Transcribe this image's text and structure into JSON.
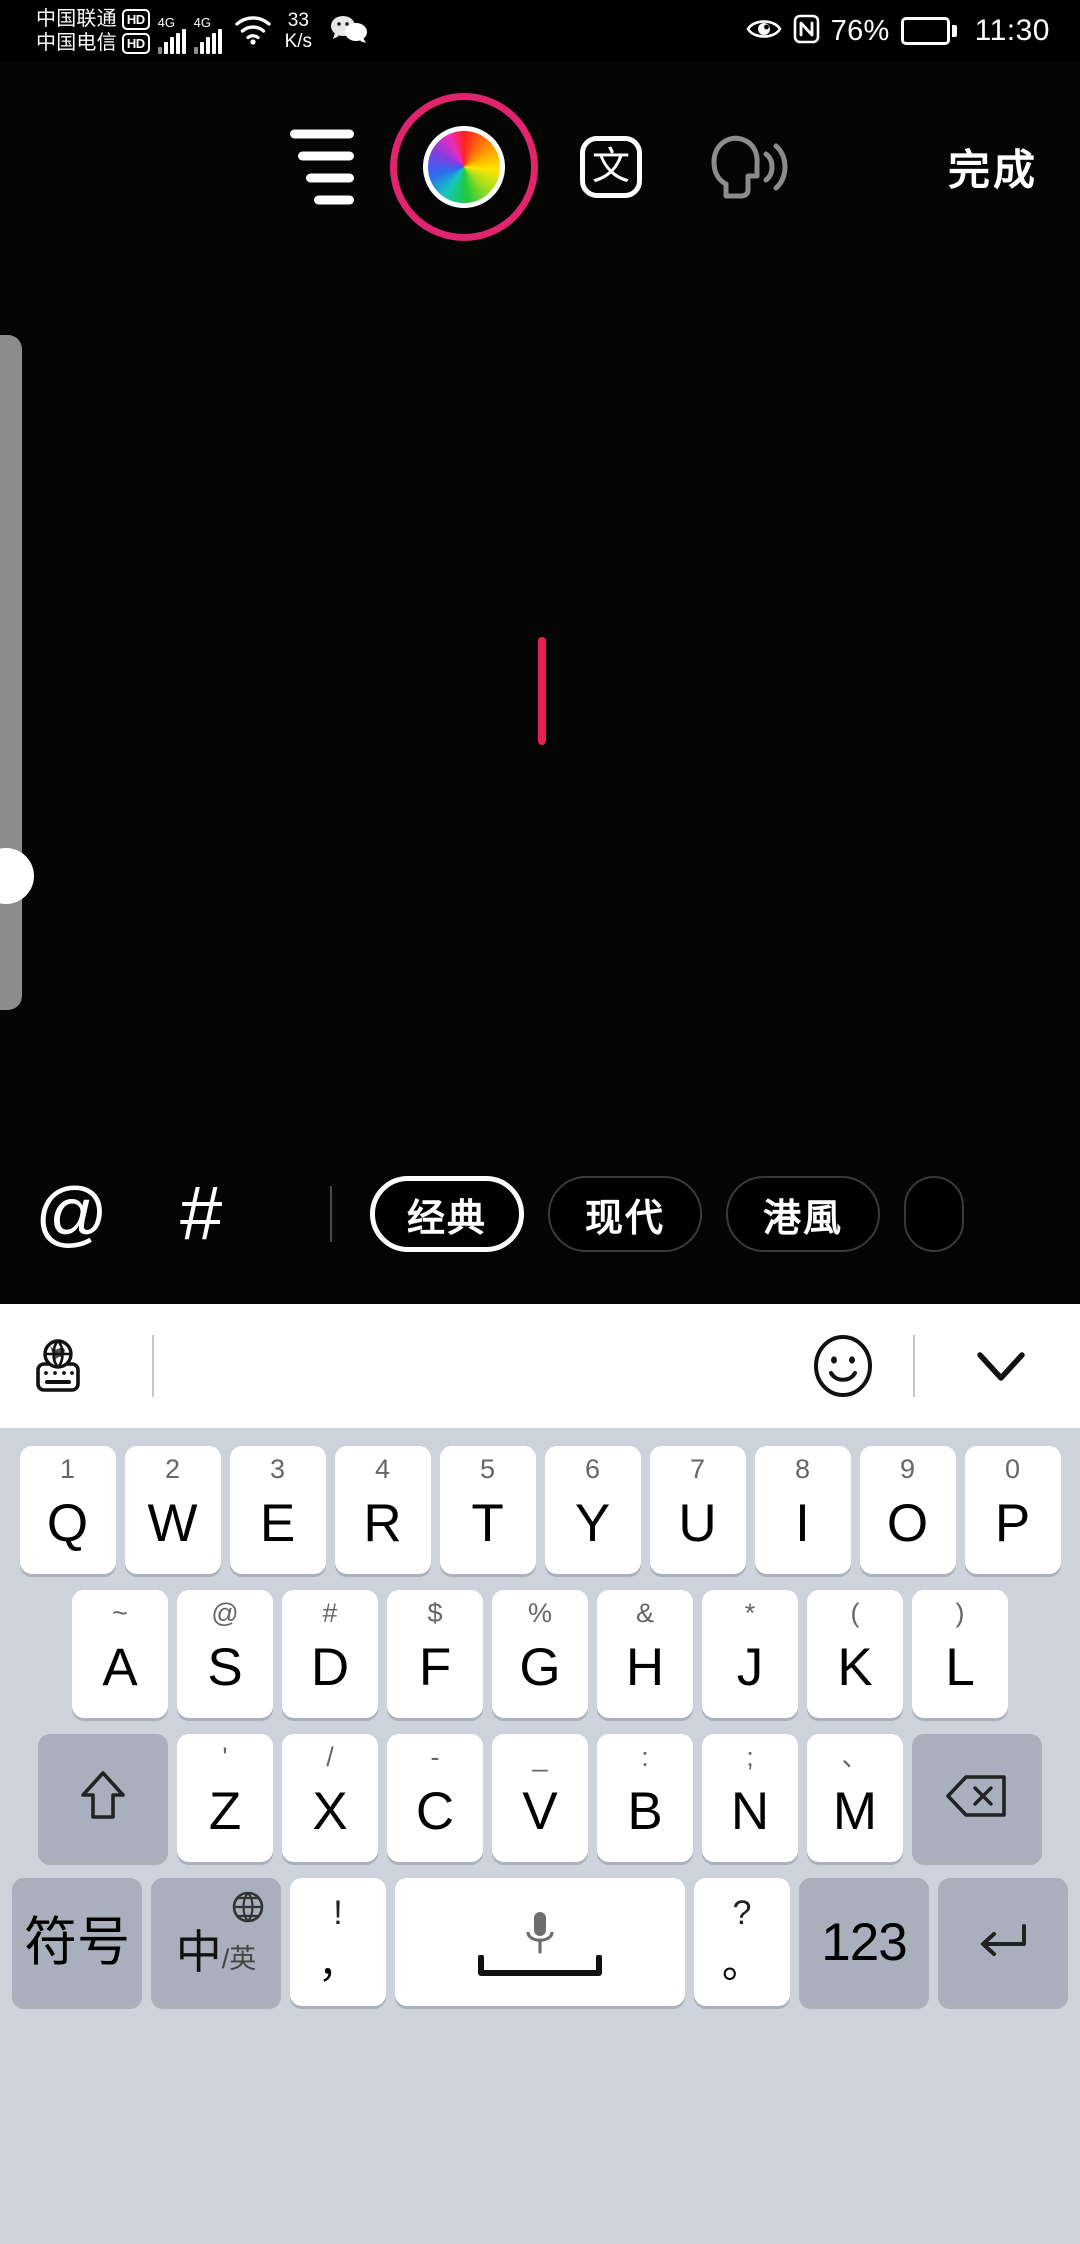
{
  "status_bar": {
    "carrier_1": "中国联通",
    "carrier_1_badge": "HD",
    "carrier_2": "中国电信",
    "carrier_2_badge": "HD",
    "network_1": "4G",
    "network_2": "4G",
    "net_speed_value": "33",
    "net_speed_unit": "K/s",
    "battery_percent": "76%",
    "time": "11:30",
    "icons": [
      "wifi-icon",
      "wechat-icon",
      "eye-comfort-icon",
      "nfc-icon",
      "battery-icon"
    ]
  },
  "editor": {
    "toolbar": {
      "align_icon": "text-align-icon",
      "color_wheel_icon": "color-wheel-icon",
      "text_style_label": "文",
      "tts_icon": "text-to-speech-icon",
      "done_label": "完成"
    },
    "caret_color": "#e8204f",
    "accent_ring_color": "#e0246e",
    "slider": {
      "name": "font-size-slider",
      "orientation": "vertical"
    }
  },
  "style_bar": {
    "mention_icon": "at-sign-icon",
    "hashtag_icon": "hashtag-icon",
    "chips": [
      {
        "label": "经典",
        "selected": true
      },
      {
        "label": "现代",
        "selected": false
      },
      {
        "label": "港風",
        "selected": false
      },
      {
        "label": "",
        "selected": false
      }
    ]
  },
  "keyboard": {
    "toolbar": {
      "language_switch_icon": "globe-keyboard-icon",
      "emoji_icon": "emoji-smiley-icon",
      "collapse_icon": "chevron-down-icon"
    },
    "row1": [
      {
        "sub": "1",
        "main": "Q"
      },
      {
        "sub": "2",
        "main": "W"
      },
      {
        "sub": "3",
        "main": "E"
      },
      {
        "sub": "4",
        "main": "R"
      },
      {
        "sub": "5",
        "main": "T"
      },
      {
        "sub": "6",
        "main": "Y"
      },
      {
        "sub": "7",
        "main": "U"
      },
      {
        "sub": "8",
        "main": "I"
      },
      {
        "sub": "9",
        "main": "O"
      },
      {
        "sub": "0",
        "main": "P"
      }
    ],
    "row2": [
      {
        "sub": "~",
        "main": "A"
      },
      {
        "sub": "@",
        "main": "S"
      },
      {
        "sub": "#",
        "main": "D"
      },
      {
        "sub": "$",
        "main": "F"
      },
      {
        "sub": "%",
        "main": "G"
      },
      {
        "sub": "&",
        "main": "H"
      },
      {
        "sub": "*",
        "main": "J"
      },
      {
        "sub": "(",
        "main": "K"
      },
      {
        "sub": ")",
        "main": "L"
      }
    ],
    "row3": {
      "shift_icon": "shift-arrow-icon",
      "keys": [
        {
          "sub": "'",
          "main": "Z"
        },
        {
          "sub": "/",
          "main": "X"
        },
        {
          "sub": "-",
          "main": "C"
        },
        {
          "sub": "_",
          "main": "V"
        },
        {
          "sub": ":",
          "main": "B"
        },
        {
          "sub": ";",
          "main": "N"
        },
        {
          "sub": "、",
          "main": "M"
        }
      ],
      "backspace_icon": "backspace-icon"
    },
    "row4": {
      "symbol_label": "符号",
      "lang_zh": "中",
      "lang_en": "/英",
      "lang_globe_icon": "globe-icon",
      "punct_left_top": "!",
      "punct_left_bottom": "，",
      "space_icon": "microphone-icon",
      "punct_right_top": "?",
      "punct_right_bottom": "。",
      "numeric_label": "123",
      "enter_icon": "enter-arrow-icon"
    }
  }
}
